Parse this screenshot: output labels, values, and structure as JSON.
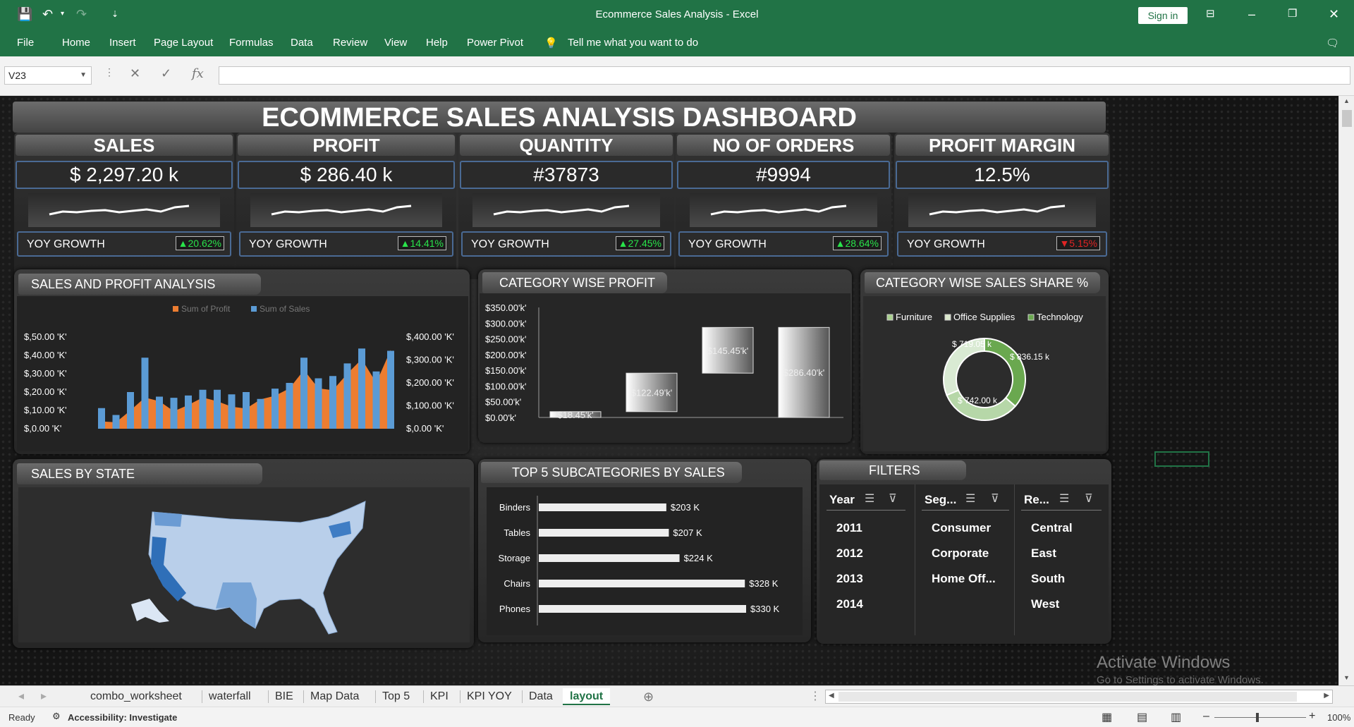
{
  "window": {
    "title": "Ecommerce Sales Analysis  -  Excel",
    "signin": "Sign in"
  },
  "ribbon": {
    "tabs": [
      "File",
      "Home",
      "Insert",
      "Page Layout",
      "Formulas",
      "Data",
      "Review",
      "View",
      "Help",
      "Power Pivot"
    ],
    "tell_me": "Tell me what you want to do"
  },
  "formula_bar": {
    "name_box": "V23",
    "formula": ""
  },
  "dashboard": {
    "title": "ECOMMERCE SALES ANALYSIS DASHBOARD",
    "kpis": [
      {
        "label": "SALES",
        "value": "$ 2,297.20 k",
        "yoy_label": "YOY GROWTH",
        "yoy": "▲20.62%",
        "color": "#29e34a"
      },
      {
        "label": "PROFIT",
        "value": "$ 286.40 k",
        "yoy_label": "YOY GROWTH",
        "yoy": "▲14.41%",
        "color": "#29e34a"
      },
      {
        "label": "QUANTITY",
        "value": "#37873",
        "yoy_label": "YOY GROWTH",
        "yoy": "▲27.45%",
        "color": "#29e34a"
      },
      {
        "label": "NO OF ORDERS",
        "value": "#9994",
        "yoy_label": "YOY GROWTH",
        "yoy": "▲28.64%",
        "color": "#29e34a"
      },
      {
        "label": "PROFIT MARGIN",
        "value": "12.5%",
        "yoy_label": "YOY GROWTH",
        "yoy": "▼5.15%",
        "color": "#e02424"
      }
    ],
    "sales_profit": {
      "title": "SALES AND PROFIT ANALYSIS",
      "legend_profit": "Sum of Profit",
      "legend_sales": "Sum of Sales",
      "left_ticks": [
        "$,50.00 'K'",
        "$,40.00 'K'",
        "$,30.00 'K'",
        "$,20.00 'K'",
        "$,10.00 'K'",
        "$,0.00 'K'"
      ],
      "right_ticks": [
        "$,400.00 'K'",
        "$,300.00 'K'",
        "$,200.00 'K'",
        "$,100.00 'K'",
        "$,0.00 'K'"
      ]
    },
    "category_profit": {
      "title": "CATEGORY WISE PROFIT",
      "ticks": [
        "$350.00'k'",
        "$300.00'k'",
        "$250.00'k'",
        "$200.00'k'",
        "$150.00'k'",
        "$100.00'k'",
        "$50.00'k'",
        "$0.00'k'"
      ],
      "labels": [
        "$18.45'k'",
        "$122.49'k'",
        "$145.45'k'",
        "$286.40'k'"
      ]
    },
    "category_share": {
      "title": "CATEGORY WISE SALES SHARE %",
      "legend": [
        "Furniture",
        "Office Supplies",
        "Technology"
      ],
      "labels": [
        "$ 719.05 k",
        "$ 836.15 k",
        "$ 742.00 k"
      ]
    },
    "state": {
      "title": "SALES BY STATE"
    },
    "top5": {
      "title": "TOP 5 SUBCATEGORIES BY SALES",
      "items": [
        "Binders",
        "Tables",
        "Storage",
        "Chairs",
        "Phones"
      ],
      "values": [
        "$203 K",
        "$207 K",
        "$224 K",
        "$328 K",
        "$330 K"
      ]
    },
    "filters": {
      "title": "FILTERS",
      "year": {
        "label": "Year",
        "items": [
          "2011",
          "2012",
          "2013",
          "2014"
        ]
      },
      "segment": {
        "label": "Seg...",
        "items": [
          "Consumer",
          "Corporate",
          "Home Off..."
        ]
      },
      "region": {
        "label": "Re...",
        "items": [
          "Central",
          "East",
          "South",
          "West"
        ]
      }
    }
  },
  "chart_data": [
    {
      "type": "bar",
      "title": "SALES AND PROFIT ANALYSIS",
      "series": [
        {
          "name": "Sum of Profit",
          "values": [
            4,
            3.5,
            10,
            17,
            15,
            9.5,
            13,
            17,
            15,
            12,
            11,
            16,
            18,
            22,
            32,
            22,
            21,
            30,
            38,
            25,
            43
          ]
        },
        {
          "name": "Sum of Sales",
          "values": [
            90,
            60,
            160,
            310,
            140,
            135,
            145,
            170,
            170,
            150,
            160,
            130,
            175,
            200,
            310,
            220,
            230,
            285,
            350,
            250,
            340
          ]
        }
      ]
    },
    {
      "type": "bar",
      "title": "CATEGORY WISE PROFIT",
      "categories": [
        "Furniture",
        "Office Supplies",
        "Technology",
        "Total"
      ],
      "values": [
        18.45,
        122.49,
        145.45,
        286.4
      ],
      "ylim": [
        0,
        350
      ]
    },
    {
      "type": "pie",
      "title": "CATEGORY WISE SALES SHARE %",
      "categories": [
        "Furniture",
        "Office Supplies",
        "Technology"
      ],
      "values": [
        742.0,
        719.05,
        836.15
      ]
    },
    {
      "type": "bar",
      "title": "TOP 5 SUBCATEGORIES BY SALES",
      "categories": [
        "Binders",
        "Tables",
        "Storage",
        "Chairs",
        "Phones"
      ],
      "values": [
        203,
        207,
        224,
        328,
        330
      ]
    }
  ],
  "activate": {
    "line1": "Activate Windows",
    "line2": "Go to Settings to activate Windows."
  },
  "sheet_tabs": [
    "combo_worksheet",
    "waterfall",
    "BIE",
    "Map Data",
    "Top 5",
    "KPI",
    "KPI YOY",
    "Data",
    "layout"
  ],
  "status": {
    "ready": "Ready",
    "accessibility": "Accessibility: Investigate",
    "zoom": "100%"
  }
}
